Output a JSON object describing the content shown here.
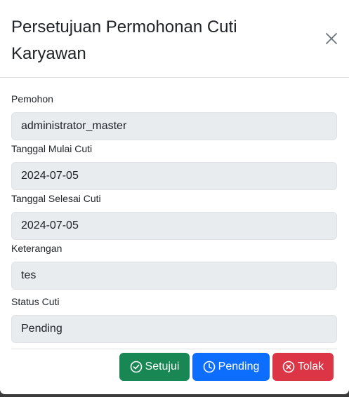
{
  "modal": {
    "title": "Persetujuan Permohonan Cuti Karyawan",
    "close_icon": "close-icon"
  },
  "fields": [
    {
      "label": "Pemohon",
      "value": "administrator_master"
    },
    {
      "label": "Tanggal Mulai Cuti",
      "value": "2024-07-05"
    },
    {
      "label": "Tanggal Selesai Cuti",
      "value": "2024-07-05"
    },
    {
      "label": "Keterangan",
      "value": "tes"
    },
    {
      "label": "Status Cuti",
      "value": "Pending"
    }
  ],
  "buttons": {
    "approve": {
      "label": "Setujui",
      "icon": "check-circle-icon",
      "color": "#198754"
    },
    "pending": {
      "label": "Pending",
      "icon": "clock-icon",
      "color": "#0d6efd"
    },
    "reject": {
      "label": "Tolak",
      "icon": "x-circle-icon",
      "color": "#dc3545"
    }
  }
}
